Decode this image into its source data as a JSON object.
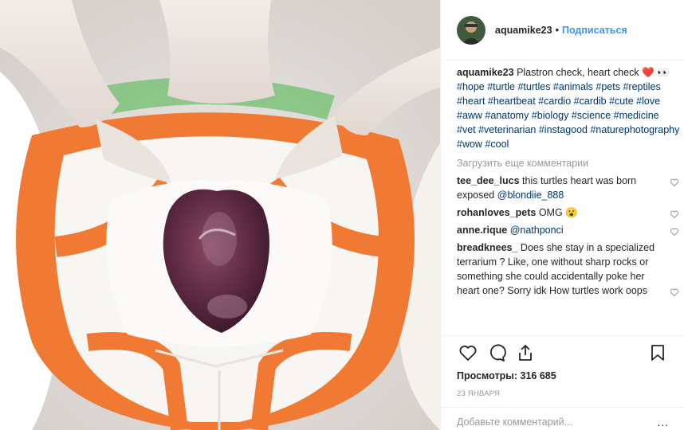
{
  "post": {
    "username": "aquamike23",
    "follow_label": "Подписаться",
    "dot": "•",
    "caption_user": "aquamike23",
    "caption_text": "Plastron check, heart check",
    "caption_emoji": "❤️ 👀",
    "hashtags": "#hope #turtle #turtles #animals #pets #reptiles #heart #heartbeat #cardio #cardib #cute #love #aww #anatomy #biology #science #medicine #vet #veterinarian #instagood #naturephotography #wow #cool",
    "load_more": "Загрузить еще комментарии"
  },
  "comments": [
    {
      "user": "tee_dee_lucs",
      "text": "this turtles heart was born exposed",
      "mention": "@blondiie_888"
    },
    {
      "user": "rohanloves_pets",
      "text": "OMG",
      "emoji": "😮"
    },
    {
      "user": "anne.rique",
      "text": "",
      "mention": "@nathponci"
    },
    {
      "user": "breadknees_",
      "text": "Does she stay in a specialized terrarium ? Like, one without sharp rocks or something she could accidentally poke her heart one? Sorry idk How turtles work oops"
    }
  ],
  "stats": {
    "views_label": "Просмотры:",
    "views_value": "316 685",
    "date": "23 ЯНВАРЯ"
  },
  "add_comment": {
    "placeholder": "Добавьте комментарий...",
    "more": "..."
  },
  "icons": {
    "like": "heart-outline-icon",
    "comment": "speech-bubble-icon",
    "share": "share-icon",
    "save": "bookmark-icon"
  },
  "colors": {
    "accent": "#3897f0",
    "hashtag": "#003569",
    "muted": "#999999",
    "shell_orange": "#f07a34"
  }
}
